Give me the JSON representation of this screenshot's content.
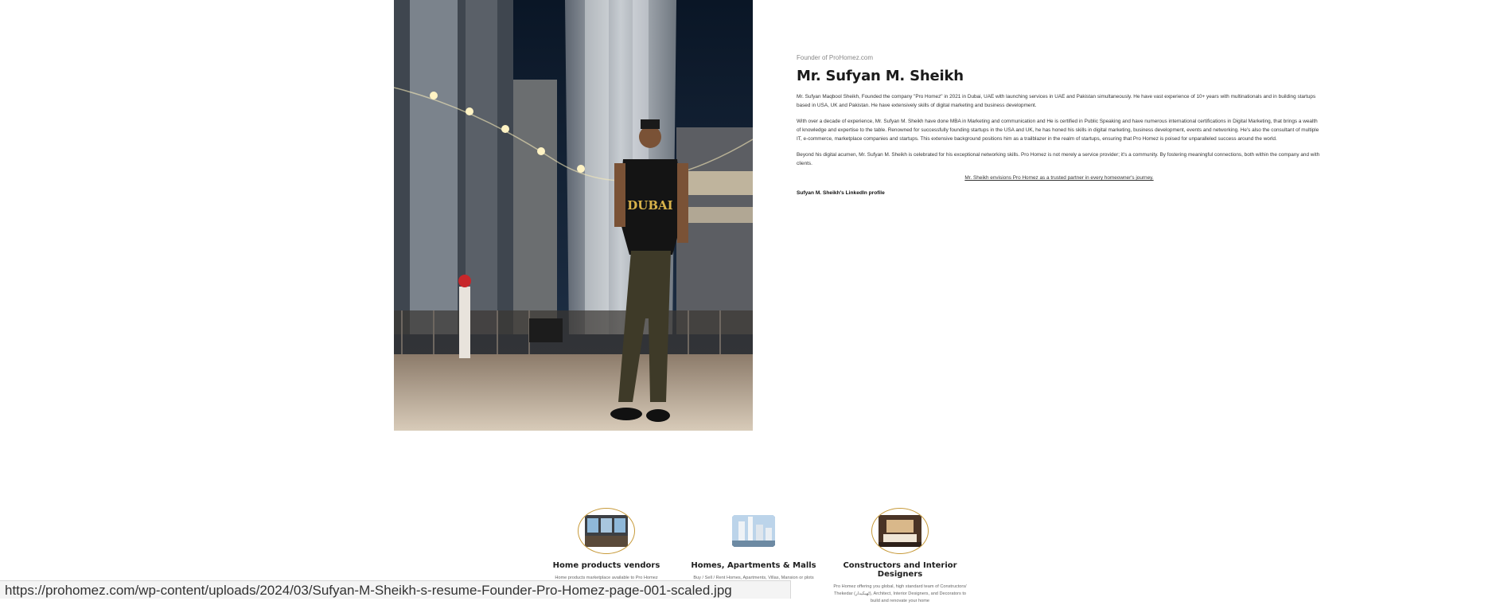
{
  "profile": {
    "eyebrow": "Founder of ProHomez.com",
    "name": "Mr. Sufyan M. Sheikh",
    "paragraphs": [
      "Mr. Sufyan Maqbool Sheikh, Founded the company \"Pro Homez\" in 2021 in Dubai, UAE with launching services in UAE and Pakistan simultaneously. He have vast experience of 10+ years with multinationals and in building startups based in USA, UK and Pakistan. He have extensively skills of digital marketing and business development.",
      "With over a decade of experience, Mr. Sufyan M. Sheikh have done MBA in Marketing and communication and He is certified in Public Speaking and have numerous international certifications in Digital Marketing, that brings a wealth of knowledge and expertise to the table. Renowned for successfully founding startups in the USA and UK, he has honed his skills in digital marketing, business development, events and networking. He's also the consultant of multiple IT, e-commerce, marketplace companies and startups.  This extensive background positions him as a trailblazer in the realm of startups, ensuring that Pro Homez is poised for unparalleled success around the world.",
      "Beyond his digital acumen, Mr. Sufyan M. Sheikh is celebrated for his exceptional networking skills. Pro Homez is not merely a service provider; it's a community. By fostering meaningful connections, both within the company and with clients."
    ],
    "vision_link": "Mr. Sheikh envisions Pro Homez as a trusted partner in every homeowner's journey.",
    "linkedin_link": "Sufyan M. Sheikh's LinkedIn profile"
  },
  "photo": {
    "shirt_text": "DUBAI"
  },
  "categories": [
    {
      "title": "Home products vendors",
      "desc": "Home products marketplace available to Pro Homez",
      "icon": "store-icon"
    },
    {
      "title": "Homes, Apartments & Malls",
      "desc": "Buy / Sell / Rent Homes, Apartments, Villas, Mansion or plots",
      "icon": "building-icon"
    },
    {
      "title": "Constructors and Interior Designers",
      "desc": "Pro Homez offering you global, high standard team of Constructors/ Thekedar (ٹھیکیدار), Architect, Interior Designers, and Decorators to build and renovate your home",
      "icon": "interior-icon"
    }
  ],
  "status_url": "https://prohomez.com/wp-content/uploads/2024/03/Sufyan-M-Sheikh-s-resume-Founder-Pro-Homez-page-001-scaled.jpg",
  "colors": {
    "accent_gold": "#c79a3a",
    "text_dark": "#1b1b1b"
  }
}
